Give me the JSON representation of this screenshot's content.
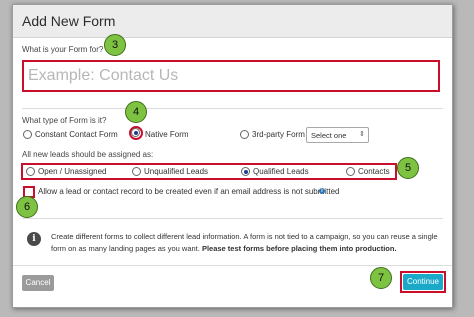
{
  "dialog": {
    "title": "Add New Form"
  },
  "form_name": {
    "label": "What is your Form for?",
    "placeholder": "Example: Contact Us",
    "value": ""
  },
  "form_type": {
    "label": "What type of Form is it?",
    "options": [
      {
        "label": "Constant Contact Form",
        "selected": false
      },
      {
        "label": "Native Form",
        "selected": true
      },
      {
        "label": "3rd-party Form",
        "selected": false
      }
    ],
    "third_party_select": {
      "selected": "Select one"
    }
  },
  "lead_assignment": {
    "label": "All new leads should be assigned as:",
    "options": [
      {
        "label": "Open / Unassigned",
        "selected": false
      },
      {
        "label": "Unqualified Leads",
        "selected": false
      },
      {
        "label": "Qualified Leads",
        "selected": true
      },
      {
        "label": "Contacts",
        "selected": false
      }
    ]
  },
  "allow_no_email": {
    "label": "Allow a lead or contact record to be created even if an email address is not submitted",
    "checked": false
  },
  "info": {
    "icon": "info-icon",
    "text": "Create different forms to collect different lead information. A form is not tied to a campaign, so you can reuse a single form on as many landing pages as you want.",
    "bold_text": "Please test forms before placing them into production."
  },
  "footer": {
    "cancel_label": "Cancel",
    "continue_label": "Continue"
  },
  "callouts": [
    "3",
    "4",
    "5",
    "6",
    "7"
  ],
  "colors": {
    "accent": "#1aa9c9",
    "highlight": "#c8102e",
    "badge": "#7ec242",
    "radio_selected": "#1e3d8f"
  }
}
